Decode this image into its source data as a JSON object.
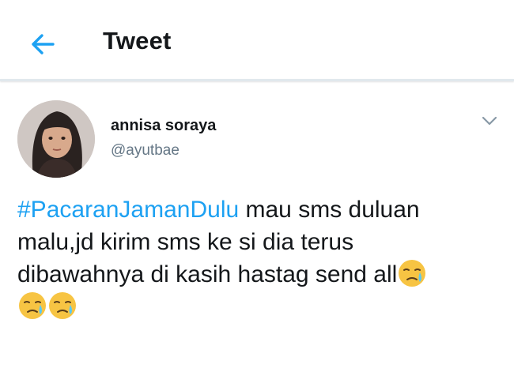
{
  "header": {
    "title": "Tweet",
    "back_icon": "arrow-left-icon",
    "accent": "#1da1f2"
  },
  "tweet": {
    "author": {
      "display_name": "annisa soraya",
      "handle": "@ayutbae",
      "avatar_icon": "avatar-photo"
    },
    "menu_icon": "chevron-down-icon",
    "hashtag": "#PacaranJamanDulu",
    "text_line1": " mau sms duluan",
    "text_line2": "malu,jd kirim sms ke si dia terus",
    "text_line3": "dibawahnya di kasih hastag send all",
    "emoji": "sad-relieved-face-emoji"
  },
  "colors": {
    "text": "#14171a",
    "secondary": "#657786",
    "hashtag": "#1da1f2"
  }
}
